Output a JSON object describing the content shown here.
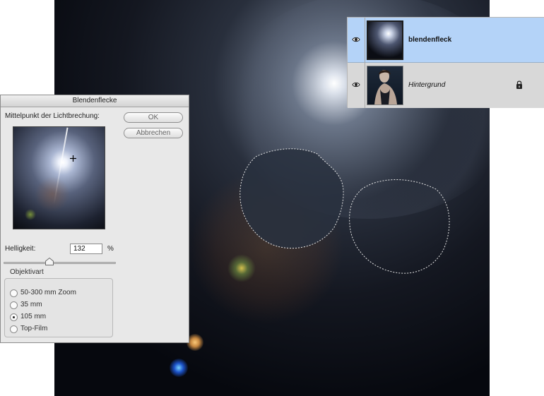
{
  "layers_panel": {
    "layers": [
      {
        "name": "blendenfleck",
        "selected": true,
        "visible": true,
        "locked": false,
        "thumb_icon": "lens-flare-thumbnail"
      },
      {
        "name": "Hintergrund",
        "selected": false,
        "visible": true,
        "locked": true,
        "thumb_icon": "woman-portrait-thumbnail"
      }
    ]
  },
  "dialog": {
    "title": "Blendenflecke",
    "center_label": "Mittelpunkt der Lichtbrechung:",
    "ok_label": "OK",
    "cancel_label": "Abbrechen",
    "brightness_label": "Helligkeit:",
    "brightness_value": "132",
    "brightness_unit": "%",
    "brightness_slider_fraction": 0.44,
    "lens_group_label": "Objektivart",
    "lens_options": [
      {
        "label": "50-300 mm Zoom",
        "checked": false
      },
      {
        "label": "35 mm",
        "checked": false
      },
      {
        "label": "105 mm",
        "checked": true
      },
      {
        "label": "Top-Film",
        "checked": false
      }
    ]
  },
  "colors": {
    "selected_layer": "#b4d3f8",
    "dialog_bg": "#e8e8e8",
    "canvas_bg": "#05070c"
  }
}
